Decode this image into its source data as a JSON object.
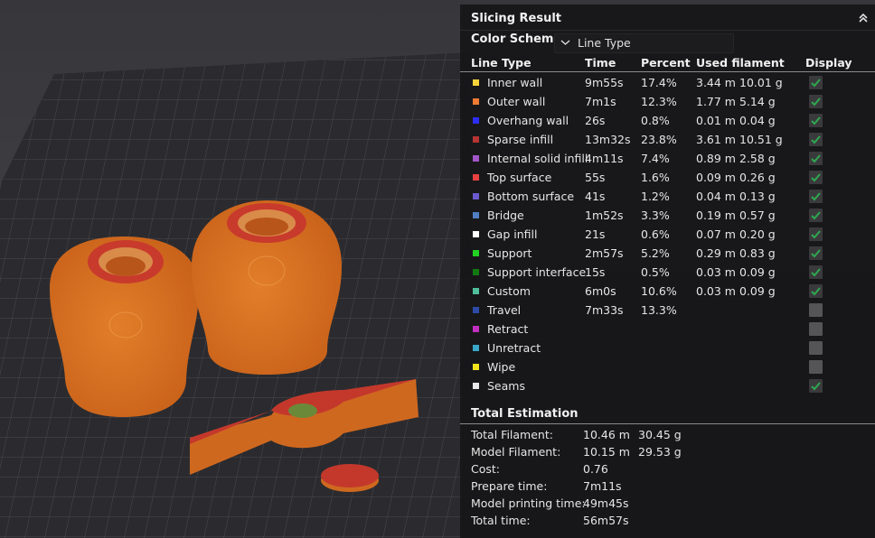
{
  "panel": {
    "title": "Slicing Result",
    "color_scheme_label": "Color Scheme",
    "color_scheme_value": "Line Type",
    "columns": [
      "Line Type",
      "Time",
      "Percent",
      "Used filament",
      "Display"
    ]
  },
  "rows": [
    {
      "name": "Inner wall",
      "time": "9m55s",
      "percent": "17.4%",
      "length": "3.44 m",
      "weight": "10.01 g",
      "color": "#f5d33a",
      "display": true
    },
    {
      "name": "Outer wall",
      "time": "7m1s",
      "percent": "12.3%",
      "length": "1.77 m",
      "weight": "5.14 g",
      "color": "#f07a33",
      "display": true
    },
    {
      "name": "Overhang wall",
      "time": "26s",
      "percent": "0.8%",
      "length": "0.01 m",
      "weight": "0.04 g",
      "color": "#2e2ef0",
      "display": true
    },
    {
      "name": "Sparse infill",
      "time": "13m32s",
      "percent": "23.8%",
      "length": "3.61 m",
      "weight": "10.51 g",
      "color": "#b53434",
      "display": true
    },
    {
      "name": "Internal solid infill",
      "time": "4m11s",
      "percent": "7.4%",
      "length": "0.89 m",
      "weight": "2.58 g",
      "color": "#a155c7",
      "display": true
    },
    {
      "name": "Top surface",
      "time": "55s",
      "percent": "1.6%",
      "length": "0.09 m",
      "weight": "0.26 g",
      "color": "#e84141",
      "display": true
    },
    {
      "name": "Bottom surface",
      "time": "41s",
      "percent": "1.2%",
      "length": "0.04 m",
      "weight": "0.13 g",
      "color": "#6a5ccf",
      "display": true
    },
    {
      "name": "Bridge",
      "time": "1m52s",
      "percent": "3.3%",
      "length": "0.19 m",
      "weight": "0.57 g",
      "color": "#4f7fc0",
      "display": true
    },
    {
      "name": "Gap infill",
      "time": "21s",
      "percent": "0.6%",
      "length": "0.07 m",
      "weight": "0.20 g",
      "color": "#ffffff",
      "display": true
    },
    {
      "name": "Support",
      "time": "2m57s",
      "percent": "5.2%",
      "length": "0.29 m",
      "weight": "0.83 g",
      "color": "#22d322",
      "display": true
    },
    {
      "name": "Support interface",
      "time": "15s",
      "percent": "0.5%",
      "length": "0.03 m",
      "weight": "0.09 g",
      "color": "#127a12",
      "display": true
    },
    {
      "name": "Custom",
      "time": "6m0s",
      "percent": "10.6%",
      "length": "0.03 m",
      "weight": "0.09 g",
      "color": "#4fbf9a",
      "display": true
    },
    {
      "name": "Travel",
      "time": "7m33s",
      "percent": "13.3%",
      "length": "",
      "weight": "",
      "color": "#2d4aa6",
      "display": false
    },
    {
      "name": "Retract",
      "time": "",
      "percent": "",
      "length": "",
      "weight": "",
      "color": "#c02fc0",
      "display": false
    },
    {
      "name": "Unretract",
      "time": "",
      "percent": "",
      "length": "",
      "weight": "",
      "color": "#3aa8c9",
      "display": false
    },
    {
      "name": "Wipe",
      "time": "",
      "percent": "",
      "length": "",
      "weight": "",
      "color": "#f2e41c",
      "display": false
    },
    {
      "name": "Seams",
      "time": "",
      "percent": "",
      "length": "",
      "weight": "",
      "color": "#e8e8e8",
      "display": true
    }
  ],
  "total": {
    "title": "Total Estimation",
    "rows": [
      {
        "label": "Total Filament:",
        "value": "10.46 m",
        "value2": "30.45 g"
      },
      {
        "label": "Model Filament:",
        "value": "10.15 m",
        "value2": "29.53 g"
      },
      {
        "label": "Cost:",
        "value": "0.76",
        "value2": ""
      },
      {
        "label": "Prepare time:",
        "value": "7m11s",
        "value2": ""
      },
      {
        "label": "Model printing time:",
        "value": "49m45s",
        "value2": ""
      },
      {
        "label": "Total time:",
        "value": "56m57s",
        "value2": ""
      }
    ]
  },
  "colors": {
    "accent_check": "#2fa84f",
    "model_orange": "#de7422",
    "model_top": "#c5392f"
  },
  "icons": [
    "collapse-up-icon",
    "chevron-down-icon",
    "checkbox-check-icon"
  ]
}
